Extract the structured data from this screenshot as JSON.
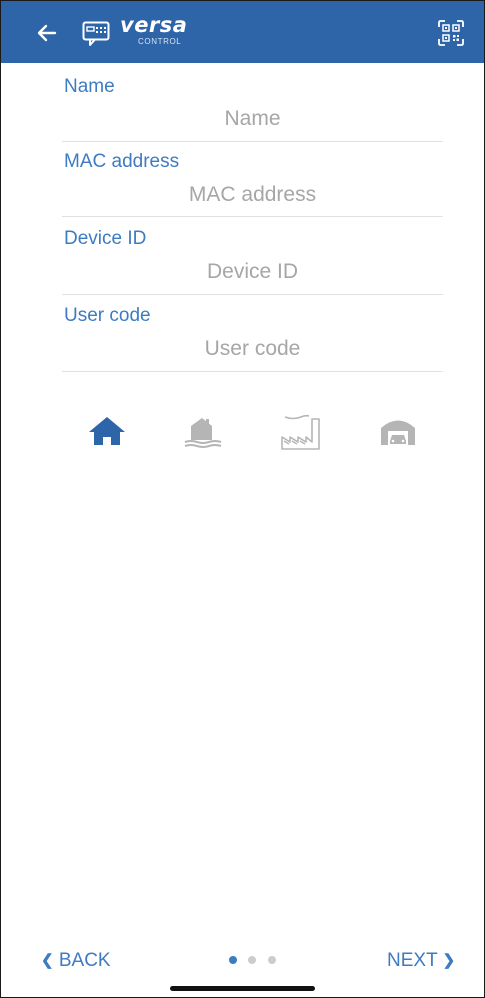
{
  "header": {
    "brand": "versa",
    "brand_sub": "CONTROL",
    "colors": {
      "background": "#2e64a8",
      "foreground": "#ffffff"
    }
  },
  "form": {
    "name": {
      "label": "Name",
      "placeholder": "Name",
      "value": ""
    },
    "mac": {
      "label": "MAC address",
      "placeholder": "MAC address",
      "value": ""
    },
    "device_id": {
      "label": "Device ID",
      "placeholder": "Device ID",
      "value": ""
    },
    "user_code": {
      "label": "User code",
      "placeholder": "User code",
      "value": ""
    }
  },
  "building_types": [
    {
      "icon": "house-icon",
      "selected": true
    },
    {
      "icon": "cottage-icon",
      "selected": false
    },
    {
      "icon": "factory-icon",
      "selected": false
    },
    {
      "icon": "garage-icon",
      "selected": false
    }
  ],
  "footer": {
    "back_label": "BACK",
    "next_label": "NEXT",
    "page_count": 3,
    "current_page": 1
  },
  "colors": {
    "accent": "#3e7bc2",
    "selected_icon": "#2e64a8",
    "inactive_icon": "#b5b5b5",
    "divider": "#e1e1e1",
    "placeholder": "#a6a6a6"
  }
}
